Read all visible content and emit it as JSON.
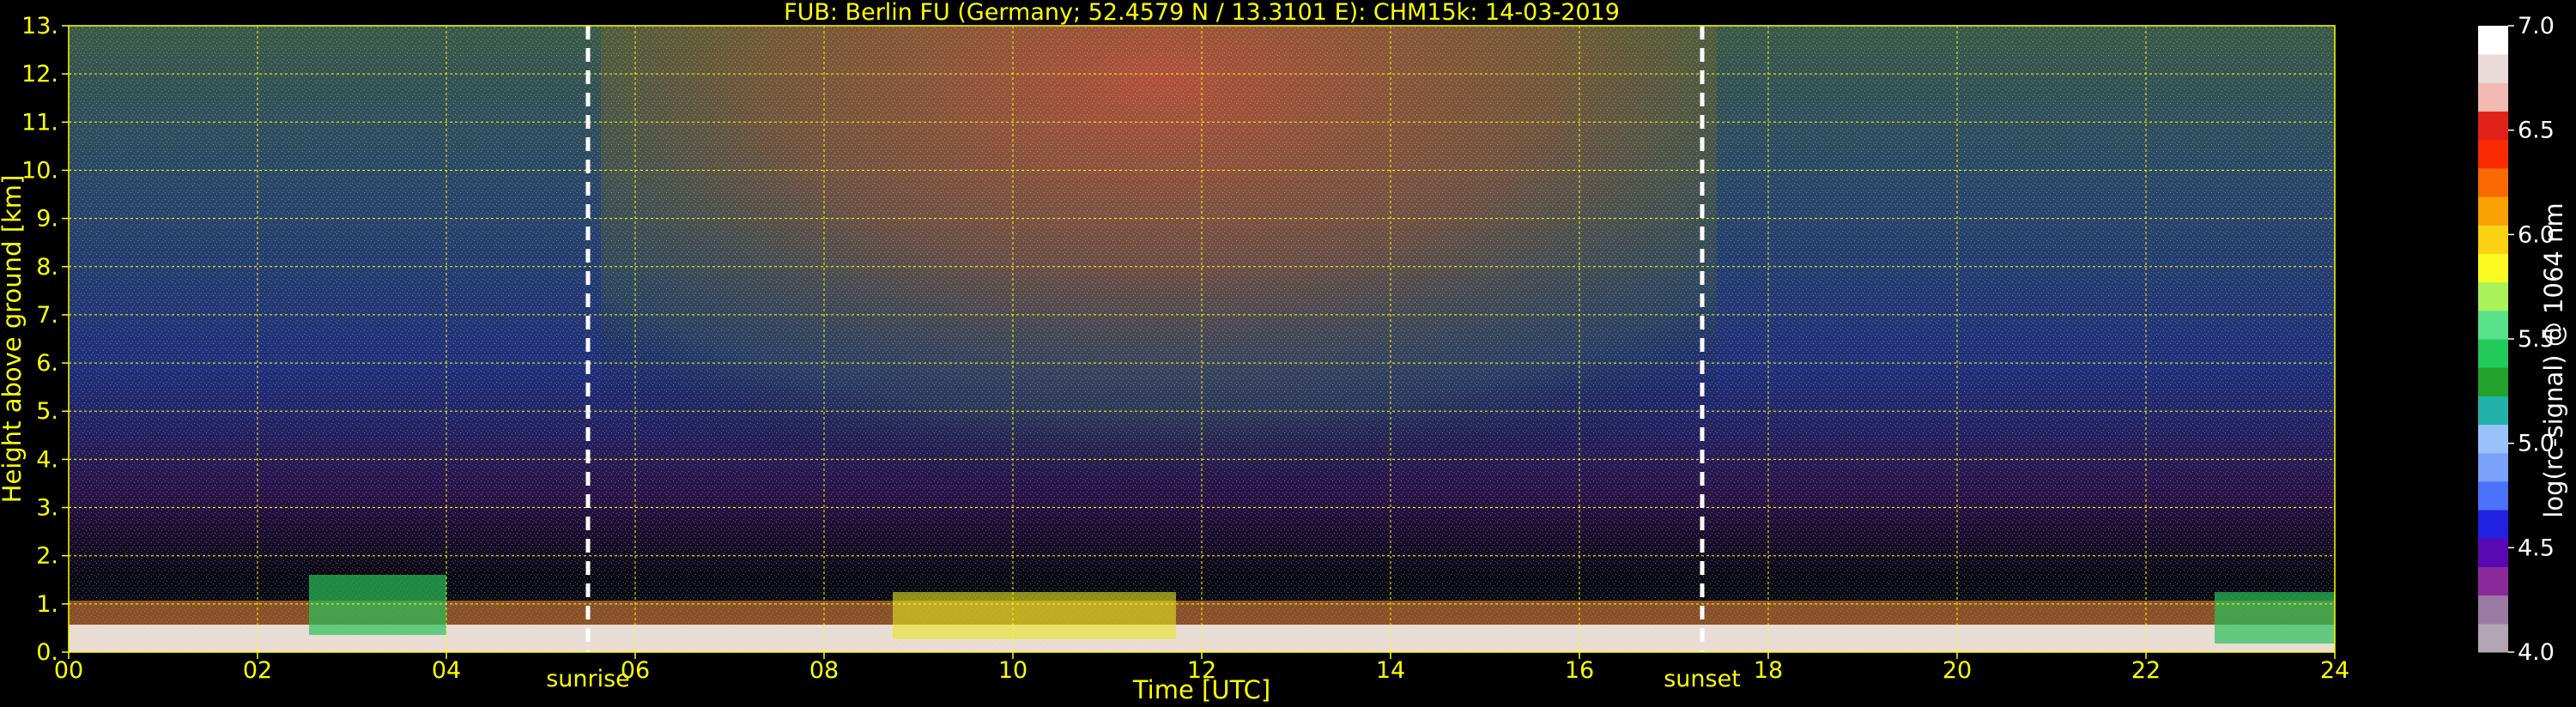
{
  "chart_data": {
    "type": "heatmap",
    "title": "FUB: Berlin FU (Germany; 52.4579 N / 13.3101 E):    CHM15k: 14-03-2019",
    "xlabel": "Time [UTC]",
    "ylabel": "Height above ground [km]",
    "colorbar_label": "log(rc-signal) @ 1064 nm",
    "xlim": [
      0,
      24
    ],
    "ylim": [
      0,
      13
    ],
    "clim": [
      4.0,
      7.0
    ],
    "x_ticks": [
      "00",
      "02",
      "04",
      "06",
      "08",
      "10",
      "12",
      "14",
      "16",
      "18",
      "20",
      "22",
      "24"
    ],
    "y_ticks": [
      "0.",
      "1.",
      "2.",
      "3.",
      "4.",
      "5.",
      "6.",
      "7.",
      "8.",
      "9.",
      "10.",
      "11.",
      "12.",
      "13."
    ],
    "colorbar_ticks": [
      "4.0",
      "4.5",
      "5.0",
      "5.5",
      "6.0",
      "6.5",
      "7.0"
    ],
    "grid": true,
    "annotations": [
      {
        "label": "sunrise",
        "x": 5.5
      },
      {
        "label": "sunset",
        "x": 17.3
      }
    ],
    "colormap": [
      "#b2a6b2",
      "#9a7aa2",
      "#8a2a9a",
      "#5a08b2",
      "#2222e2",
      "#4a72fa",
      "#7aa2fa",
      "#9ac2fa",
      "#22b2aa",
      "#22a22a",
      "#22ca5a",
      "#5ae28a",
      "#aaf25a",
      "#fafa22",
      "#fad212",
      "#faa202",
      "#fa6a02",
      "#fa2a02",
      "#e2221a",
      "#f2bab2",
      "#eadada",
      "#ffffff"
    ]
  }
}
